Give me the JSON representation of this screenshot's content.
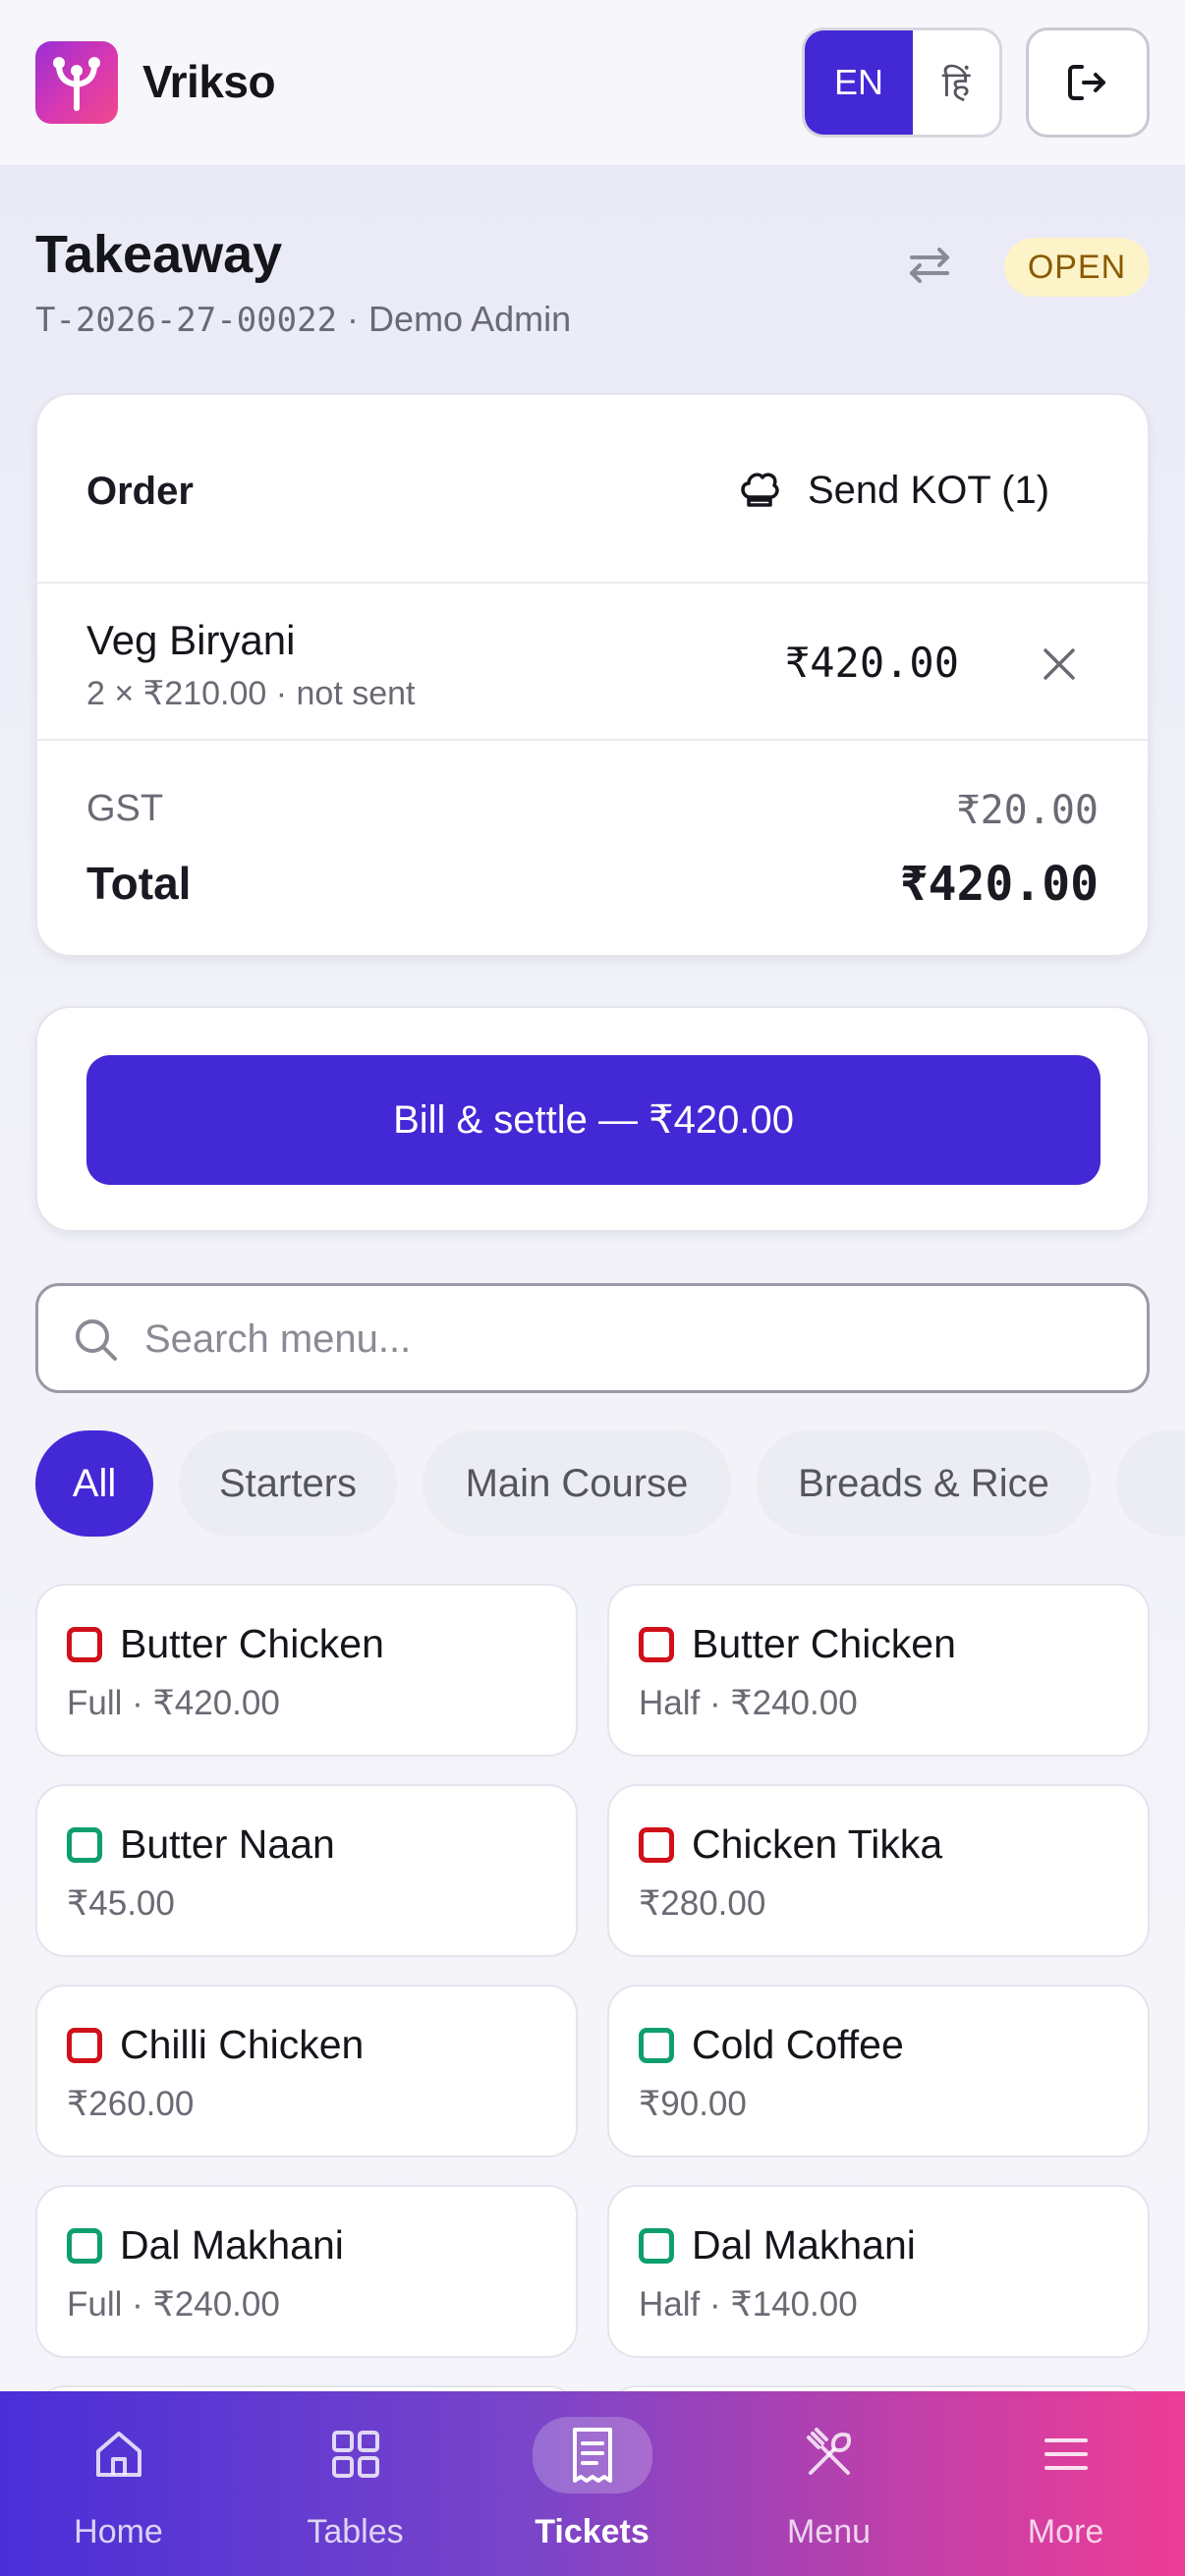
{
  "header": {
    "brand": "Vrikso",
    "lang_en": "EN",
    "lang_hi": "हिं"
  },
  "ticket": {
    "title": "Takeaway",
    "number": "T-2026-27-00022",
    "separator": " · ",
    "owner": "Demo Admin",
    "status": "OPEN"
  },
  "order": {
    "label": "Order",
    "send_kot_label": "Send KOT (1)",
    "items": [
      {
        "name": "Veg Biryani",
        "detail": "2 × ₹210.00 · not sent",
        "amount": "₹420.00"
      }
    ],
    "gst_label": "GST",
    "gst_amount": "₹20.00",
    "total_label": "Total",
    "total_amount": "₹420.00"
  },
  "settle": {
    "button_label": "Bill & settle — ₹420.00"
  },
  "search": {
    "placeholder": "Search menu..."
  },
  "categories": {
    "items": [
      {
        "label": "All",
        "active": true
      },
      {
        "label": "Starters",
        "active": false
      },
      {
        "label": "Main Course",
        "active": false
      },
      {
        "label": "Breads & Rice",
        "active": false
      }
    ]
  },
  "menu": {
    "items": [
      {
        "name": "Butter Chicken",
        "price": "Full · ₹420.00",
        "veg": false
      },
      {
        "name": "Butter Chicken",
        "price": "Half · ₹240.00",
        "veg": false
      },
      {
        "name": "Butter Naan",
        "price": "₹45.00",
        "veg": true
      },
      {
        "name": "Chicken Tikka",
        "price": "₹280.00",
        "veg": false
      },
      {
        "name": "Chilli Chicken",
        "price": "₹260.00",
        "veg": false
      },
      {
        "name": "Cold Coffee",
        "price": "₹90.00",
        "veg": true
      },
      {
        "name": "Dal Makhani",
        "price": "Full · ₹240.00",
        "veg": true
      },
      {
        "name": "Dal Makhani",
        "price": "Half · ₹140.00",
        "veg": true
      }
    ]
  },
  "nav": {
    "items": [
      {
        "label": "Home",
        "icon": "home-icon",
        "active": false
      },
      {
        "label": "Tables",
        "icon": "grid-icon",
        "active": false
      },
      {
        "label": "Tickets",
        "icon": "receipt-icon",
        "active": true
      },
      {
        "label": "Menu",
        "icon": "utensils-icon",
        "active": false
      },
      {
        "label": "More",
        "icon": "menu-lines-icon",
        "active": false
      }
    ]
  },
  "colors": {
    "accent": "#4328d6",
    "veg": "#0e9f6e",
    "nonveg": "#d0101a",
    "status_bg": "#fdf3c9",
    "status_text": "#8a5a00"
  }
}
